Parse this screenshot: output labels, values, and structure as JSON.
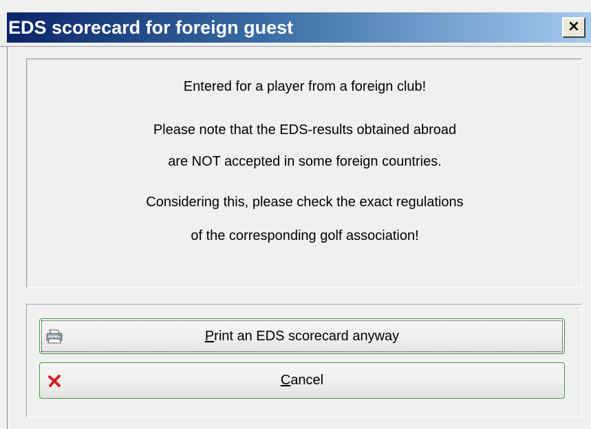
{
  "window": {
    "title": "EDS scorecard for foreign guest",
    "close_glyph": "×"
  },
  "message": {
    "line1": "Entered for a player from a foreign club!",
    "line2": "Please note that the EDS-results obtained abroad",
    "line3": "are NOT accepted in some foreign countries.",
    "line4": "Considering this, please check the exact regulations",
    "line5": "of the corresponding golf association!"
  },
  "buttons": {
    "print": {
      "label_mnemonic": "P",
      "label_rest": "rint an EDS scorecard anyway",
      "icon": "printer-icon",
      "focused": true
    },
    "cancel": {
      "label_mnemonic": "C",
      "label_rest": "ancel",
      "icon": "red-x-icon",
      "focused": false
    }
  },
  "colors": {
    "title_gradient_start": "#0a246a",
    "title_gradient_end": "#a6caf0",
    "button_border": "#3c9a3c",
    "cancel_icon": "#d42020"
  }
}
